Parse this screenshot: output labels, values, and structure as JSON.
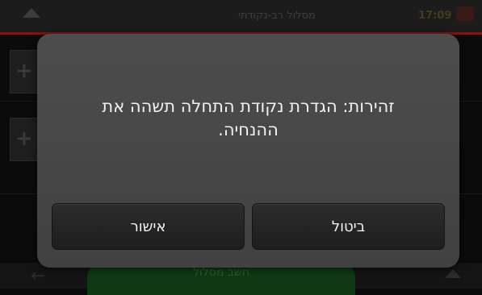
{
  "header": {
    "title": "מסלול רב-נקודתי",
    "time": "17:09"
  },
  "bottom": {
    "calculate_route_label": "חשב מסלול"
  },
  "dialog": {
    "message_line1": "זהירות: הגדרת נקודת התחלה תשהה את",
    "message_line2": "ההנחיה.",
    "confirm_label": "אישור",
    "cancel_label": "ביטול"
  },
  "colors": {
    "accent": "#7a1a10",
    "dialog_bg": "#474747",
    "button_bg": "#242424",
    "text": "#f2f2f2",
    "route_button": "#0f3a14"
  }
}
